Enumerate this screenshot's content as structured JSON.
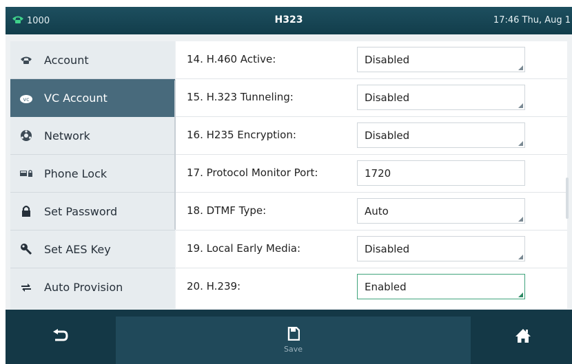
{
  "status_bar": {
    "line_label": "1000",
    "title": "H323",
    "clock": "17:46 Thu, Aug 1"
  },
  "sidebar": {
    "items": [
      {
        "label": "Account",
        "icon": "phone-icon"
      },
      {
        "label": "VC Account",
        "icon": "vc-account-icon"
      },
      {
        "label": "Network",
        "icon": "network-icon"
      },
      {
        "label": "Phone Lock",
        "icon": "phone-lock-icon"
      },
      {
        "label": "Set Password",
        "icon": "lock-icon"
      },
      {
        "label": "Set AES Key",
        "icon": "key-icon"
      },
      {
        "label": "Auto Provision",
        "icon": "sync-icon"
      }
    ],
    "active_index": 1
  },
  "settings": {
    "rows": [
      {
        "label": "14. H.460 Active:",
        "value": "Disabled",
        "type": "select"
      },
      {
        "label": "15. H.323 Tunneling:",
        "value": "Disabled",
        "type": "select"
      },
      {
        "label": "16. H235 Encryption:",
        "value": "Disabled",
        "type": "select"
      },
      {
        "label": "17. Protocol Monitor Port:",
        "value": "1720",
        "type": "input"
      },
      {
        "label": "18. DTMF Type:",
        "value": "Auto",
        "type": "select"
      },
      {
        "label": "19. Local Early Media:",
        "value": "Disabled",
        "type": "select"
      },
      {
        "label": "20. H.239:",
        "value": "Enabled",
        "type": "select",
        "selected": true
      }
    ]
  },
  "bottom_bar": {
    "save_label": "Save",
    "back_icon": "back-arrow-icon",
    "save_icon": "save-icon",
    "home_icon": "home-icon"
  },
  "colors": {
    "status_bar_bg": "#123d4b",
    "sidebar_active_bg": "#486a7c",
    "bottom_bar_bg": "#143846",
    "selected_field_border": "#3fa37b"
  }
}
